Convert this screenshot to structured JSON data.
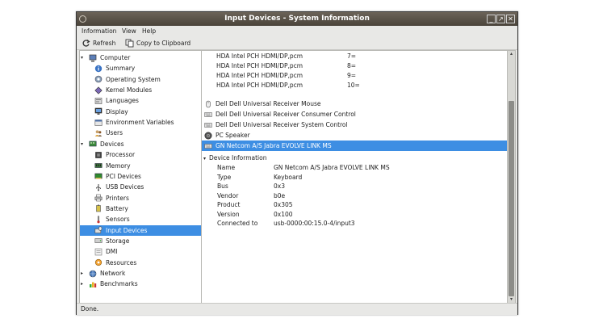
{
  "window": {
    "title": "Input Devices - System Information"
  },
  "titlebar_buttons": {
    "minimize": "_",
    "maximize": "↗",
    "close": "✕"
  },
  "menu": [
    "Information",
    "View",
    "Help"
  ],
  "toolbar": {
    "refresh_label": "Refresh",
    "copy_label": "Copy to Clipboard"
  },
  "tree": [
    {
      "label": "Computer",
      "level": 0,
      "expanded": true,
      "icon": "computer-icon"
    },
    {
      "label": "Summary",
      "level": 1,
      "icon": "info-icon"
    },
    {
      "label": "Operating System",
      "level": 1,
      "icon": "os-icon"
    },
    {
      "label": "Kernel Modules",
      "level": 1,
      "icon": "module-icon"
    },
    {
      "label": "Languages",
      "level": 1,
      "icon": "language-icon"
    },
    {
      "label": "Display",
      "level": 1,
      "icon": "display-icon"
    },
    {
      "label": "Environment Variables",
      "level": 1,
      "icon": "env-icon"
    },
    {
      "label": "Users",
      "level": 1,
      "icon": "users-icon"
    },
    {
      "label": "Devices",
      "level": 0,
      "expanded": true,
      "icon": "devices-icon"
    },
    {
      "label": "Processor",
      "level": 1,
      "icon": "processor-icon"
    },
    {
      "label": "Memory",
      "level": 1,
      "icon": "memory-icon"
    },
    {
      "label": "PCI Devices",
      "level": 1,
      "icon": "pci-icon"
    },
    {
      "label": "USB Devices",
      "level": 1,
      "icon": "usb-icon"
    },
    {
      "label": "Printers",
      "level": 1,
      "icon": "printer-icon"
    },
    {
      "label": "Battery",
      "level": 1,
      "icon": "battery-icon"
    },
    {
      "label": "Sensors",
      "level": 1,
      "icon": "sensor-icon"
    },
    {
      "label": "Input Devices",
      "level": 1,
      "selected": true,
      "icon": "input-device-icon"
    },
    {
      "label": "Storage",
      "level": 1,
      "icon": "storage-icon"
    },
    {
      "label": "DMI",
      "level": 1,
      "icon": "dmi-icon"
    },
    {
      "label": "Resources",
      "level": 1,
      "icon": "resources-icon"
    },
    {
      "label": "Network",
      "level": 0,
      "expanded": false,
      "icon": "network-icon"
    },
    {
      "label": "Benchmarks",
      "level": 0,
      "expanded": false,
      "icon": "benchmark-icon"
    }
  ],
  "pcm_rows": [
    {
      "name": "HDA Intel PCH HDMI/DP,pcm",
      "value": "7="
    },
    {
      "name": "HDA Intel PCH HDMI/DP,pcm",
      "value": "8="
    },
    {
      "name": "HDA Intel PCH HDMI/DP,pcm",
      "value": "9="
    },
    {
      "name": "HDA Intel PCH HDMI/DP,pcm",
      "value": "10="
    }
  ],
  "devices": [
    {
      "label": "Dell Dell Universal Receiver Mouse",
      "icon": "mouse-icon"
    },
    {
      "label": "Dell Dell Universal Receiver Consumer Control",
      "icon": "keyboard-icon"
    },
    {
      "label": "Dell Dell Universal Receiver System Control",
      "icon": "keyboard-icon"
    },
    {
      "label": "PC Speaker",
      "icon": "speaker-icon"
    },
    {
      "label": "GN Netcom A/S Jabra EVOLVE LINK MS",
      "icon": "keyboard-icon",
      "selected": true
    }
  ],
  "device_info": {
    "header": "Device Information",
    "rows": [
      {
        "key": "Name",
        "value": "GN Netcom A/S Jabra EVOLVE LINK MS"
      },
      {
        "key": "Type",
        "value": "Keyboard"
      },
      {
        "key": "Bus",
        "value": "0x3"
      },
      {
        "key": "Vendor",
        "value": "b0e"
      },
      {
        "key": "Product",
        "value": "0x305"
      },
      {
        "key": "Version",
        "value": "0x100"
      },
      {
        "key": "Connected to",
        "value": "usb-0000:00:15.0-4/input3"
      }
    ]
  },
  "status": {
    "text": "Done."
  },
  "colors": {
    "selection": "#3d8ee3",
    "titlebar": "#5a5349"
  }
}
